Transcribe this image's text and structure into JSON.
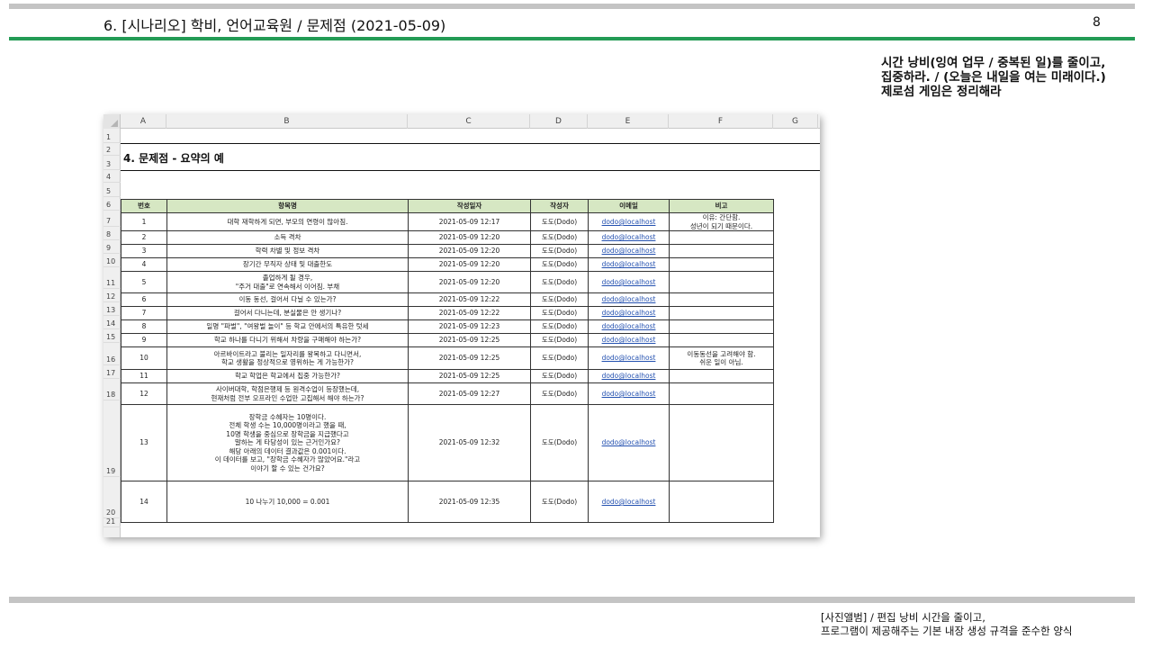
{
  "header": {
    "title": "6. [시나리오] 학비, 언어교육원 / 문제점 (2021-05-09)",
    "page_number": "8"
  },
  "side_note": {
    "lines": [
      "시간 낭비(잉여 업무 / 중복된 일)를 줄이고,",
      "집중하라. / (오늘은 내일을 여는 미래이다.)",
      "제로섬 게임은 정리해라"
    ]
  },
  "footer": {
    "lines": [
      "[사진앨범] / 편집 낭비 시간을 줄이고,",
      "프로그램이 제공해주는 기본 내장 생성 규격을 준수한 양식"
    ]
  },
  "sheet": {
    "columns": [
      "A",
      "B",
      "C",
      "D",
      "E",
      "F",
      "G"
    ],
    "row_numbers": [
      "1",
      "2",
      "3",
      "4",
      "5",
      "6",
      "7",
      "8",
      "9",
      "10",
      "11",
      "12",
      "13",
      "14",
      "15",
      "16",
      "17",
      "18",
      "19",
      "20",
      "21"
    ],
    "section_title": "4. 문제점 - 요약의 예",
    "table": {
      "headers": [
        "번호",
        "항목명",
        "작성일자",
        "작성자",
        "이메일",
        "비고"
      ],
      "rows": [
        [
          "1",
          "대학 재학하게 되면, 부모의 연령이 많아짐.",
          "2021-05-09 12:17",
          "도도(Dodo)",
          "dodo@localhost",
          "이유: 간단함.\n성년이 되기 때문이다."
        ],
        [
          "2",
          "소득 격차",
          "2021-05-09 12:20",
          "도도(Dodo)",
          "dodo@localhost",
          ""
        ],
        [
          "3",
          "학력 차별 및 정보 격차",
          "2021-05-09 12:20",
          "도도(Dodo)",
          "dodo@localhost",
          ""
        ],
        [
          "4",
          "장기간 무직자 상태 및 대출한도",
          "2021-05-09 12:20",
          "도도(Dodo)",
          "dodo@localhost",
          ""
        ],
        [
          "5",
          "졸업하게 될 경우,\n\"주거 대출\"로 연속해서 이어짐. 부채",
          "2021-05-09 12:20",
          "도도(Dodo)",
          "dodo@localhost",
          ""
        ],
        [
          "6",
          "이동 동선, 걸어서 다닐 수 있는가?",
          "2021-05-09 12:22",
          "도도(Dodo)",
          "dodo@localhost",
          ""
        ],
        [
          "7",
          "걸어서 다니는데, 분실물은 안 생기나?",
          "2021-05-09 12:22",
          "도도(Dodo)",
          "dodo@localhost",
          ""
        ],
        [
          "8",
          "일명 \"파벌\", \"여왕벌 놀이\" 등 학교 안에서의 특유한 텃세",
          "2021-05-09 12:23",
          "도도(Dodo)",
          "dodo@localhost",
          ""
        ],
        [
          "9",
          "학교 하나를 다니기 위해서 차량을 구매해야 하는가?",
          "2021-05-09 12:25",
          "도도(Dodo)",
          "dodo@localhost",
          ""
        ],
        [
          "10",
          "아르바이트라고 불리는 일자리를 왕복하고 다니면서,\n학교 생활을 정상적으로 영위하는 게 가능한가?",
          "2021-05-09 12:25",
          "도도(Dodo)",
          "dodo@localhost",
          "이동동선을 고려해야 함.\n쉬운 일이 아님."
        ],
        [
          "11",
          "학교 학업은 학교에서 집중 가능한가?",
          "2021-05-09 12:25",
          "도도(Dodo)",
          "dodo@localhost",
          ""
        ],
        [
          "12",
          "사이버대학, 학점은행제 등 원격수업이 등장했는데,\n현재처럼 전부 오프라인 수업만 고집해서 해야 하는가?",
          "2021-05-09 12:27",
          "도도(Dodo)",
          "dodo@localhost",
          ""
        ],
        [
          "13",
          "장학금 수혜자는 10명이다.\n전체 학생 수는 10,000명이라고 했을 때,\n10명 학생을 중심으로 장학금을 지급했다고\n말하는 게 타당성이 있는 근거인가요?\n해당 아래의 데이터 결과값은 0.001이다.\n이 데이터를 보고, \"장학금 수혜자가 많았어요.\"라고\n이야기 할 수 있는 건가요?",
          "2021-05-09 12:32",
          "도도(Dodo)",
          "dodo@localhost",
          ""
        ],
        [
          "14",
          "10 나누기 10,000 = 0.001",
          "2021-05-09 12:35",
          "도도(Dodo)",
          "dodo@localhost",
          ""
        ]
      ]
    }
  }
}
